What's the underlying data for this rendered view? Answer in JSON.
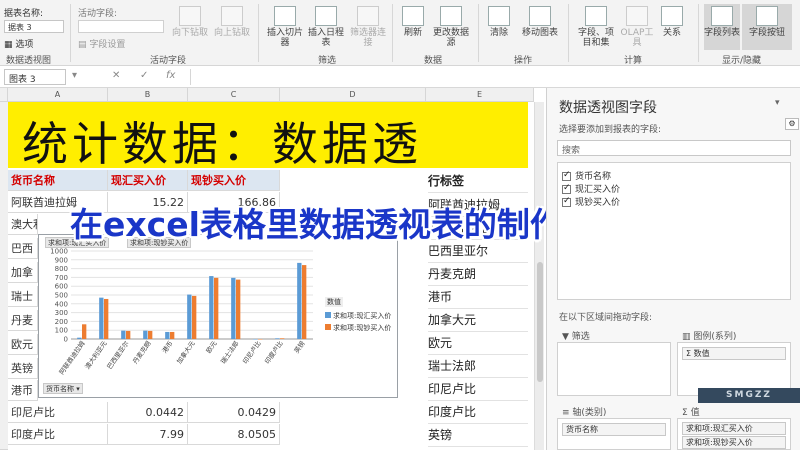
{
  "ribbon": {
    "pivot_name_label": "据表名称:",
    "pivot_name_value": "据表 3",
    "options_label": "选项",
    "active_field_label": "活动字段:",
    "field_settings_label": "字段设置",
    "drill_down_label": "向下钻取",
    "drill_up_label": "向上钻取",
    "insert_slicer_label": "插入切片器",
    "insert_timeline_label": "插入日程表",
    "filter_conn_label": "筛选器连接",
    "refresh_label": "刷新",
    "change_source_label": "更改数据源",
    "clear_label": "清除",
    "move_pivot_label": "移动图表",
    "fields_items_label": "字段、项目和集",
    "olap_label": "OLAP工具",
    "relationships_label": "关系",
    "field_list_label": "字段列表",
    "field_buttons_label": "字段按钮",
    "group_pivot": "数据透视图",
    "group_active": "活动字段",
    "group_filter": "筛选",
    "group_data": "数据",
    "group_actions": "操作",
    "group_calc": "计算",
    "group_showhide": "显示/隐藏"
  },
  "formula_bar": {
    "name_box": "图表 3",
    "fx": "fx"
  },
  "columns": [
    "A",
    "B",
    "C",
    "D",
    "E"
  ],
  "banner_text": "统计数据：数据透",
  "table": {
    "headers": [
      "货币名称",
      "现汇买入价",
      "现钞买入价"
    ],
    "rows": [
      [
        "阿联酋迪拉姆",
        "15.22",
        "166.86"
      ],
      [
        "澳大利亚元",
        "",
        ""
      ],
      [
        "巴西",
        "",
        ""
      ],
      [
        "加拿",
        "",
        ""
      ],
      [
        "瑞士",
        "",
        ""
      ],
      [
        "丹麦",
        "",
        ""
      ],
      [
        "欧元",
        "",
        ""
      ],
      [
        "英镑",
        "",
        ""
      ],
      [
        "港币",
        "",
        ""
      ],
      [
        "印尼卢比",
        "0.0442",
        "0.0429"
      ],
      [
        "印度卢比",
        "7.99",
        "8.0505"
      ]
    ]
  },
  "caption": "在excel表格里数据透视表的制作柱状图",
  "chart": {
    "chip_series1": "求和项:现汇买入价",
    "chip_series2": "求和项:现钞买入价",
    "legend_title": "数值",
    "axis_filter_chip": "货币名称 ▾"
  },
  "chart_data": {
    "type": "bar",
    "categories": [
      "阿联酋迪拉姆",
      "澳大利亚元",
      "巴西里亚尔",
      "丹麦克朗",
      "港币",
      "加拿大元",
      "欧元",
      "瑞士法郎",
      "印尼卢比",
      "印度卢比",
      "英镑"
    ],
    "series": [
      {
        "name": "求和项:现汇买入价",
        "values": [
          15,
          470,
          95,
          95,
          80,
          505,
          715,
          695,
          0.04,
          8,
          865
        ]
      },
      {
        "name": "求和项:现钞买入价",
        "values": [
          167,
          455,
          92,
          92,
          80,
          490,
          695,
          675,
          0.04,
          8,
          840
        ]
      }
    ],
    "ylim": [
      0,
      1000
    ],
    "yticks": [
      0,
      100,
      200,
      300,
      400,
      500,
      600,
      700,
      800,
      900,
      1000
    ],
    "colors": [
      "#5b9bd5",
      "#ed7d31"
    ],
    "legend_position": "right",
    "grid": true
  },
  "pivot_rows": {
    "header": "行标签",
    "items": [
      "阿联酋迪拉姆",
      "澳大利亚元",
      "巴西里亚尔",
      "丹麦克朗",
      "港币",
      "加拿大元",
      "欧元",
      "瑞士法郎",
      "印尼卢比",
      "印度卢比",
      "英镑"
    ]
  },
  "task_pane": {
    "title": "数据透视图字段",
    "subtitle": "选择要添加到报表的字段:",
    "search_placeholder": "搜索",
    "fields": [
      {
        "label": "货币名称",
        "checked": true
      },
      {
        "label": "现汇买入价",
        "checked": true
      },
      {
        "label": "现钞买入价",
        "checked": true
      }
    ],
    "drag_hint": "在以下区域间拖动字段:",
    "filters_label": "筛选",
    "legend_label": "图例(系列)",
    "legend_item": "Σ 数值",
    "axis_label": "轴(类别)",
    "axis_item": "货币名称",
    "values_label": "值",
    "value_item_1": "求和项:现汇买入价",
    "value_item_2": "求和项:现钞买入价"
  },
  "watermark": "SMGZZ"
}
